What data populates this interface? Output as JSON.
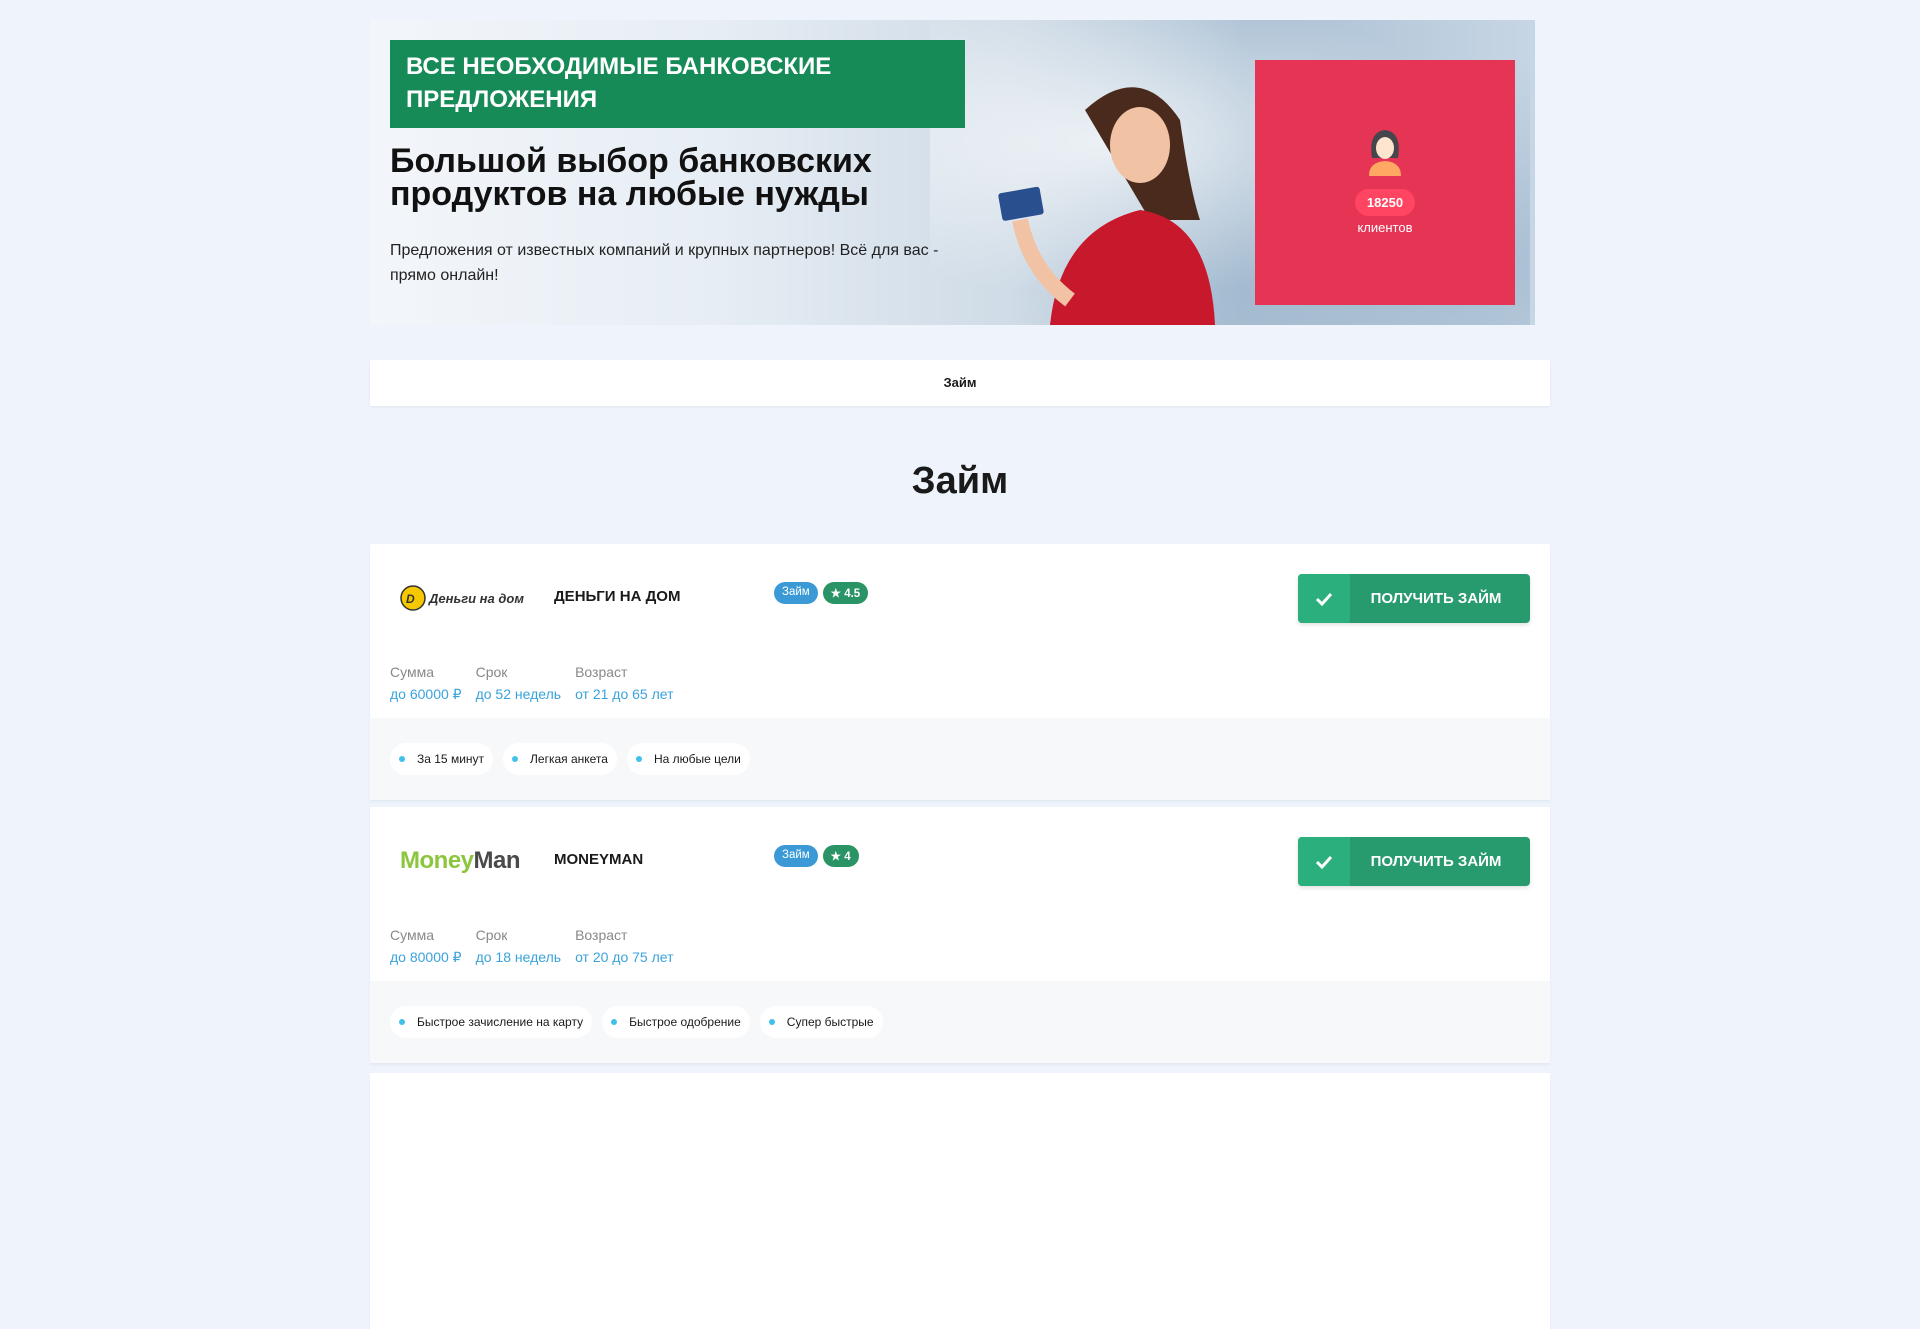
{
  "banner": {
    "tagline": "ВСЕ НЕОБХОДИМЫЕ БАНКОВСКИЕ ПРЕДЛОЖЕНИЯ",
    "headline": "Большой выбор банковских продуктов на любые нужды",
    "subtext": "Предложения от известных компаний и крупных партнеров! Всё для вас - прямо онлайн!",
    "stat": {
      "count": "18250",
      "label": "клиентов"
    }
  },
  "tabs": [
    {
      "label": "Займ"
    }
  ],
  "section_title": "Займ",
  "offers": [
    {
      "logo": "Деньги на дом",
      "name": "ДЕНЬГИ НА ДОМ",
      "type": "Займ",
      "rating": "4.5",
      "button": "ПОЛУЧИТЬ ЗАЙМ",
      "params": [
        {
          "label": "Сумма",
          "value": "до 60000 ₽"
        },
        {
          "label": "Срок",
          "value": "до 52 недель"
        },
        {
          "label": "Возраст",
          "value": "от 21 до 65 лет"
        }
      ],
      "features": [
        "За 15 минут",
        "Легкая анкета",
        "На любые цели"
      ]
    },
    {
      "logo": "MoneyMan",
      "name": "MONEYMAN",
      "type": "Займ",
      "rating": "4",
      "button": "ПОЛУЧИТЬ ЗАЙМ",
      "params": [
        {
          "label": "Сумма",
          "value": "до 80000 ₽"
        },
        {
          "label": "Срок",
          "value": "до 18 недель"
        },
        {
          "label": "Возраст",
          "value": "от 20 до 75 лет"
        }
      ],
      "features": [
        "Быстрое зачисление на карту",
        "Быстрое одобрение",
        "Супер быстрые"
      ]
    }
  ],
  "colors": {
    "brand_green": "#168a57",
    "stat_red": "#e63455",
    "link_blue": "#3aa3dc"
  }
}
